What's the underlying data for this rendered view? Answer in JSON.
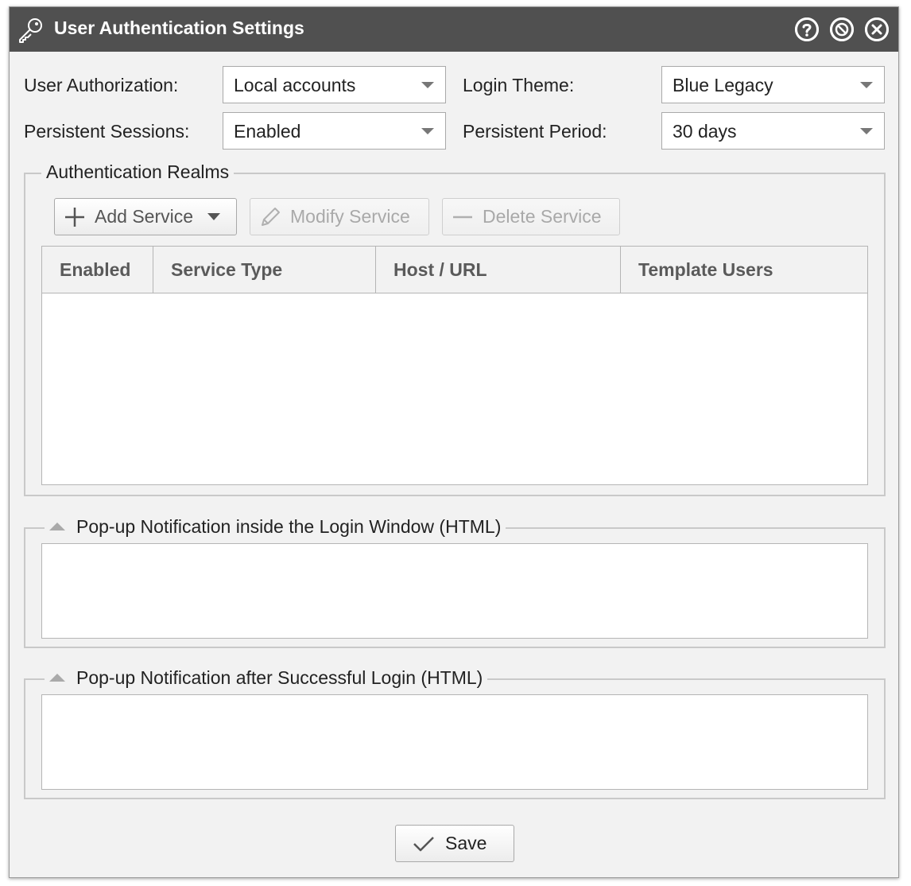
{
  "window": {
    "title": "User Authentication Settings",
    "icons": [
      "key-icon",
      "help-icon",
      "minimize-icon",
      "close-icon"
    ]
  },
  "settings": {
    "user_authorization": {
      "label": "User Authorization:",
      "value": "Local accounts"
    },
    "login_theme": {
      "label": "Login Theme:",
      "value": "Blue Legacy"
    },
    "persistent_sessions": {
      "label": "Persistent Sessions:",
      "value": "Enabled"
    },
    "persistent_period": {
      "label": "Persistent Period:",
      "value": "30 days"
    }
  },
  "realms": {
    "legend": "Authentication Realms",
    "add_label": "Add Service",
    "modify_label": "Modify Service",
    "delete_label": "Delete Service",
    "columns": [
      "Enabled",
      "Service Type",
      "Host / URL",
      "Template Users"
    ],
    "rows": []
  },
  "login_window_notification": {
    "legend": "Pop-up Notification inside the Login Window (HTML)",
    "value": ""
  },
  "after_login_notification": {
    "legend": "Pop-up Notification after Successful Login (HTML)",
    "value": ""
  },
  "footer": {
    "save_label": "Save"
  },
  "colors": {
    "titlebar": "#505050",
    "background": "#f2f2f2",
    "disabled_text": "#a9a9a9"
  }
}
